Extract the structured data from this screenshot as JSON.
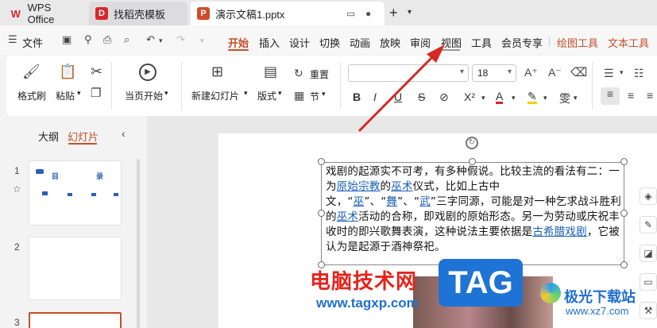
{
  "titlebar": {
    "tabs": [
      {
        "label": "WPS Office",
        "logo": "W"
      },
      {
        "label": "找稻壳模板",
        "logo": "D"
      },
      {
        "label": "演示文稿1.pptx",
        "logo": "P"
      }
    ],
    "new_tab": "+",
    "dropdown": "▾"
  },
  "menubar": {
    "file": "文件",
    "items": [
      "开始",
      "插入",
      "设计",
      "切换",
      "动画",
      "放映",
      "审阅",
      "视图",
      "工具",
      "会员专享"
    ],
    "context_items": [
      "绘图工具",
      "文本工具"
    ]
  },
  "ribbon": {
    "format_painter": "格式刷",
    "paste": "粘贴",
    "play_from_current": "当页开始",
    "new_slide": "新建幻灯片",
    "layout": "版式",
    "reset": "重置",
    "section": "节",
    "font_name": "",
    "font_size": "18"
  },
  "leftpanel": {
    "tab_outline": "大纲",
    "tab_slides": "幻灯片",
    "slides": [
      {
        "num": "1",
        "title_a": "目",
        "title_b": "录"
      },
      {
        "num": "2"
      },
      {
        "num": "3"
      }
    ]
  },
  "slide_text": {
    "p1": "戏剧的起源实不可考，有多种假说。比较主流的看法有二：一为",
    "link1": "原始宗教",
    "p2": "的",
    "link2": "巫术",
    "p3": "仪式，比如上古中文，",
    "q1": "“",
    "link3": "巫",
    "q2": "”、“",
    "link4": "舞",
    "q3": "”、“",
    "link5": "武",
    "p4": "”三字同源，可能是对一种乞求战斗胜利的",
    "link6": "巫术",
    "p5": "活动的合称，即戏剧的原始形态。另一为劳动或庆祝丰收时的即兴歌舞表演，这种说法主要依据是",
    "link7": "古希腊戏剧",
    "p6": "，它被认为是起源于酒神祭祀。"
  },
  "watermarks": {
    "site_name": "电脑技术网",
    "site_url": "www.tagxp.com",
    "tag_logo": "TAG",
    "xz_name": "极光下载站",
    "xz_url": "www.xz7.com"
  },
  "colors": {
    "accent": "#c4502b",
    "link": "#1a5fb4",
    "arrow": "#d42a22"
  }
}
